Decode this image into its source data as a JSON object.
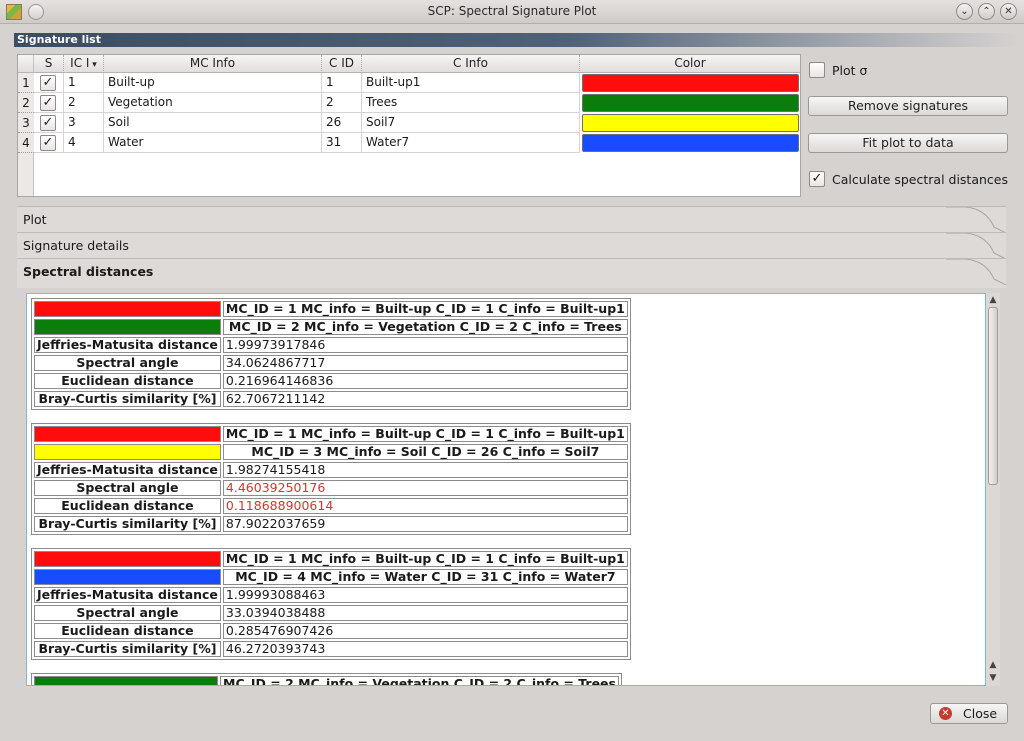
{
  "window": {
    "title": "SCP: Spectral Signature Plot"
  },
  "signature_list": {
    "header": "Signature list",
    "columns": [
      "S",
      "IC I",
      "MC Info",
      "C ID",
      "C Info",
      "Color"
    ],
    "rows": [
      {
        "row": "1",
        "checked": true,
        "mc_id": "1",
        "mc_info": "Built-up",
        "c_id": "1",
        "c_info": "Built-up1",
        "color": "#ff0d0d"
      },
      {
        "row": "2",
        "checked": true,
        "mc_id": "2",
        "mc_info": "Vegetation",
        "c_id": "2",
        "c_info": "Trees",
        "color": "#0a7d0a"
      },
      {
        "row": "3",
        "checked": true,
        "mc_id": "3",
        "mc_info": "Soil",
        "c_id": "26",
        "c_info": "Soil7",
        "color": "#ffff00"
      },
      {
        "row": "4",
        "checked": true,
        "mc_id": "4",
        "mc_info": "Water",
        "c_id": "31",
        "c_info": "Water7",
        "color": "#1a4cff"
      }
    ]
  },
  "controls": {
    "plot_sigma_label": "Plot σ",
    "plot_sigma_checked": false,
    "remove_signatures_label": "Remove signatures",
    "fit_plot_label": "Fit plot to data",
    "calc_distances_label": "Calculate spectral distances",
    "calc_distances_checked": true
  },
  "tabs": {
    "plot": "Plot",
    "signature_details": "Signature details",
    "spectral_distances": "Spectral distances"
  },
  "distances": [
    {
      "sig_a": {
        "color": "#ff0d0d",
        "text": "MC_ID = 1 MC_info = Built-up C_ID = 1 C_info = Built-up1"
      },
      "sig_b": {
        "color": "#0a7d0a",
        "text": "MC_ID = 2 MC_info = Vegetation C_ID = 2 C_info = Trees"
      },
      "jm_label": "Jeffries-Matusita distance",
      "jm": "1.99973917846",
      "sa_label": "Spectral angle",
      "sa": "34.0624867717",
      "ed_label": "Euclidean distance",
      "ed": "0.216964146836",
      "bc_label": "Bray-Curtis similarity [%]",
      "bc": "62.7067211142",
      "sa_red": false,
      "ed_red": false
    },
    {
      "sig_a": {
        "color": "#ff0d0d",
        "text": "MC_ID = 1 MC_info = Built-up C_ID = 1 C_info = Built-up1"
      },
      "sig_b": {
        "color": "#ffff00",
        "text": "MC_ID = 3 MC_info = Soil C_ID = 26 C_info = Soil7"
      },
      "jm_label": "Jeffries-Matusita distance",
      "jm": "1.98274155418",
      "sa_label": "Spectral angle",
      "sa": "4.46039250176",
      "ed_label": "Euclidean distance",
      "ed": "0.118688900614",
      "bc_label": "Bray-Curtis similarity [%]",
      "bc": "87.9022037659",
      "sa_red": true,
      "ed_red": true
    },
    {
      "sig_a": {
        "color": "#ff0d0d",
        "text": "MC_ID = 1 MC_info = Built-up C_ID = 1 C_info = Built-up1"
      },
      "sig_b": {
        "color": "#1a4cff",
        "text": "MC_ID = 4 MC_info = Water C_ID = 31 C_info = Water7"
      },
      "jm_label": "Jeffries-Matusita distance",
      "jm": "1.99993088463",
      "sa_label": "Spectral angle",
      "sa": "33.0394038488",
      "ed_label": "Euclidean distance",
      "ed": "0.285476907426",
      "bc_label": "Bray-Curtis similarity [%]",
      "bc": "46.2720393743",
      "sa_red": false,
      "ed_red": false
    },
    {
      "sig_a": {
        "color": "#0a7d0a",
        "text": "MC_ID = 2 MC_info = Vegetation C_ID = 2 C_info = Trees"
      }
    }
  ],
  "close_label": "Close"
}
